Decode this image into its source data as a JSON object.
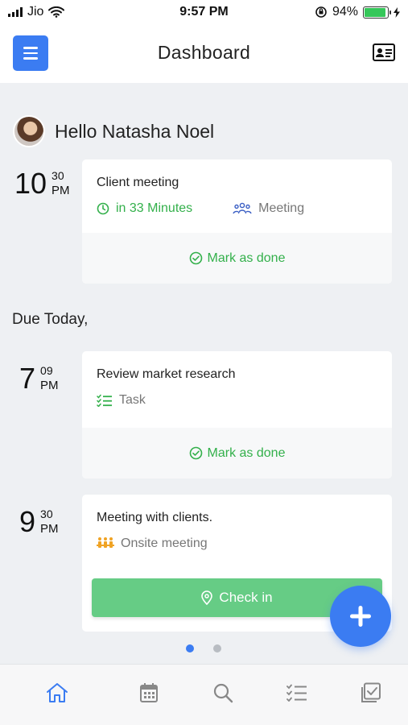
{
  "status_bar": {
    "carrier": "Jio",
    "time": "9:57 PM",
    "battery_percent": "94%",
    "battery_level": 0.94,
    "icons": [
      "signal-icon",
      "wifi-icon",
      "orientation-lock-icon",
      "battery-icon",
      "charging-icon"
    ]
  },
  "header": {
    "title": "Dashboard",
    "menu_icon": "hamburger-menu-icon",
    "right_icon": "contact-card-icon"
  },
  "greeting": {
    "text": "Hello Natasha Noel"
  },
  "upcoming": {
    "hour": "10",
    "minute": "30",
    "ampm": "PM",
    "title": "Client meeting",
    "eta": "in 33 Minutes",
    "type": "Meeting",
    "action": "Mark as done"
  },
  "due_today": {
    "heading": "Due Today,",
    "items": [
      {
        "hour": "7",
        "minute": "09",
        "ampm": "PM",
        "title": "Review market research",
        "type": "Task",
        "action": "Mark as done"
      },
      {
        "hour": "9",
        "minute": "30",
        "ampm": "PM",
        "title": "Meeting with clients.",
        "type": "Onsite meeting",
        "action": "Check in"
      }
    ]
  },
  "pagination": {
    "pages": 2,
    "active": 1
  },
  "bottom_nav": {
    "tabs": [
      "home-icon",
      "calendar-icon",
      "search-icon",
      "task-list-icon",
      "checklist-icon"
    ],
    "active": "home-icon"
  },
  "colors": {
    "primary": "#3b7cf2",
    "success": "#33b04b",
    "checkin": "#66cc85",
    "background": "#eef0f3"
  }
}
